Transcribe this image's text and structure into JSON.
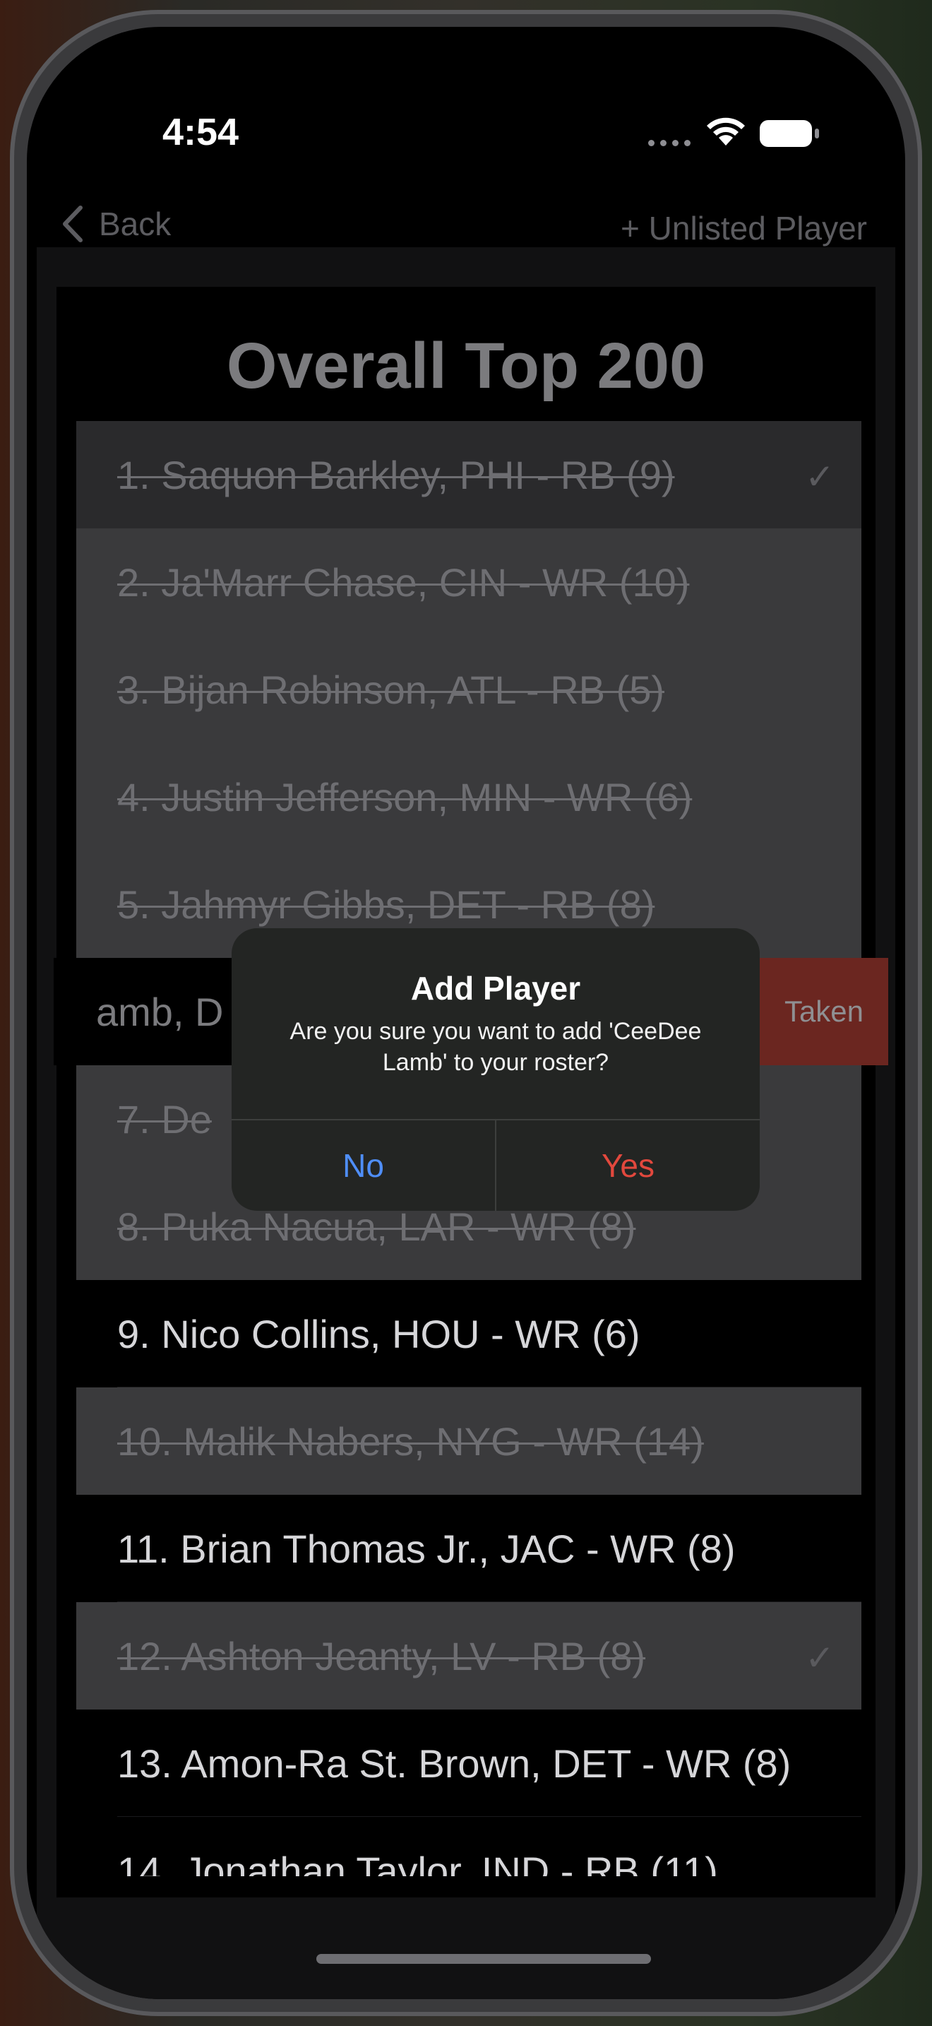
{
  "status_bar": {
    "time": "4:54"
  },
  "nav": {
    "back_label": "Back",
    "unlisted_label": "+ Unlisted Player"
  },
  "title": "Overall Top 200",
  "rows": [
    {
      "text": "1.  Saquon Barkley,  PHI - RB (9)",
      "state": "taken",
      "checked": true
    },
    {
      "text": "2.  Ja'Marr Chase,  CIN - WR (10)",
      "state": "taken",
      "checked": false
    },
    {
      "text": "3.  Bijan Robinson,  ATL - RB (5)",
      "state": "taken",
      "checked": false
    },
    {
      "text": "4.  Justin Jefferson,  MIN - WR (6)",
      "state": "taken",
      "checked": false
    },
    {
      "text": "5.  Jahmyr Gibbs,  DET - RB (8)",
      "state": "taken",
      "checked": false
    },
    {
      "text": "6.  CeeDee Lamb,  DAL - WR (10)",
      "state": "swiped",
      "checked": false
    },
    {
      "text": "7.  De",
      "state": "taken",
      "checked": false
    },
    {
      "text": "8.  Puka Nacua,  LAR - WR (8)",
      "state": "taken",
      "checked": false
    },
    {
      "text": "9.  Nico Collins,  HOU - WR (6)",
      "state": "open",
      "checked": false
    },
    {
      "text": "10.  Malik Nabers,  NYG - WR (14)",
      "state": "taken",
      "checked": false
    },
    {
      "text": "11.  Brian Thomas Jr.,  JAC - WR (8)",
      "state": "open",
      "checked": false
    },
    {
      "text": "12.  Ashton Jeanty,  LV - RB (8)",
      "state": "taken",
      "checked": true
    },
    {
      "text": "13.  Amon-Ra St. Brown,  DET - WR (8)",
      "state": "open",
      "checked": false
    },
    {
      "text": "14.  Jonathan Taylor,  IND - RB (11)",
      "state": "open",
      "checked": false
    }
  ],
  "swipe_row": {
    "visible_text": "amb,  D",
    "action_label": "Taken"
  },
  "alert": {
    "title": "Add Player",
    "message": "Are you sure you want to add 'CeeDee Lamb' to your roster?",
    "no_label": "No",
    "yes_label": "Yes",
    "no_color": "#4f8ef7",
    "yes_color": "#e2483d"
  },
  "check_glyph": "✓"
}
